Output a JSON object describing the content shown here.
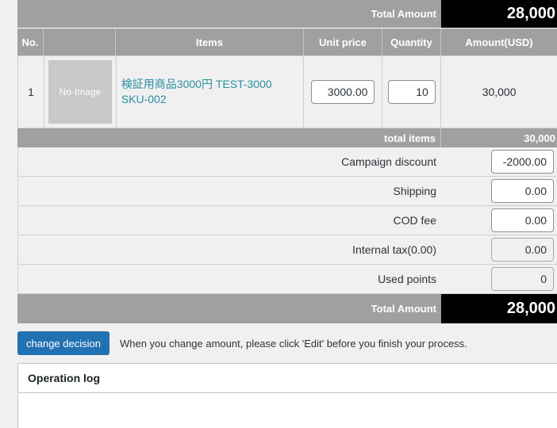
{
  "top_total": {
    "label": "Total Amount",
    "value": "28,000"
  },
  "columns": {
    "no": "No.",
    "image": "",
    "items": "Items",
    "unit_price": "Unit price",
    "quantity": "Quantity",
    "amount": "Amount(USD)"
  },
  "item": {
    "no": "1",
    "image_placeholder": "No-Image",
    "name": "検証用商品3000円 TEST-3000 SKU-002",
    "unit_price": "3000.00",
    "quantity": "10",
    "amount": "30,000"
  },
  "subtotal": {
    "label": "total items",
    "value": "30,000"
  },
  "fees": {
    "campaign_discount": {
      "label": "Campaign discount",
      "value": "-2000.00"
    },
    "shipping": {
      "label": "Shipping",
      "value": "0.00"
    },
    "cod_fee": {
      "label": "COD fee",
      "value": "0.00"
    },
    "internal_tax": {
      "label": "Internal tax(0.00)",
      "value": "0.00"
    },
    "used_points": {
      "label": "Used points",
      "value": "0"
    }
  },
  "bottom_total": {
    "label": "Total Amount",
    "value": "28,000"
  },
  "actions": {
    "change_decision_label": "change decision",
    "note": "When you change amount, please click 'Edit' before you finish your process."
  },
  "operation_log": {
    "title": "Operation log"
  }
}
